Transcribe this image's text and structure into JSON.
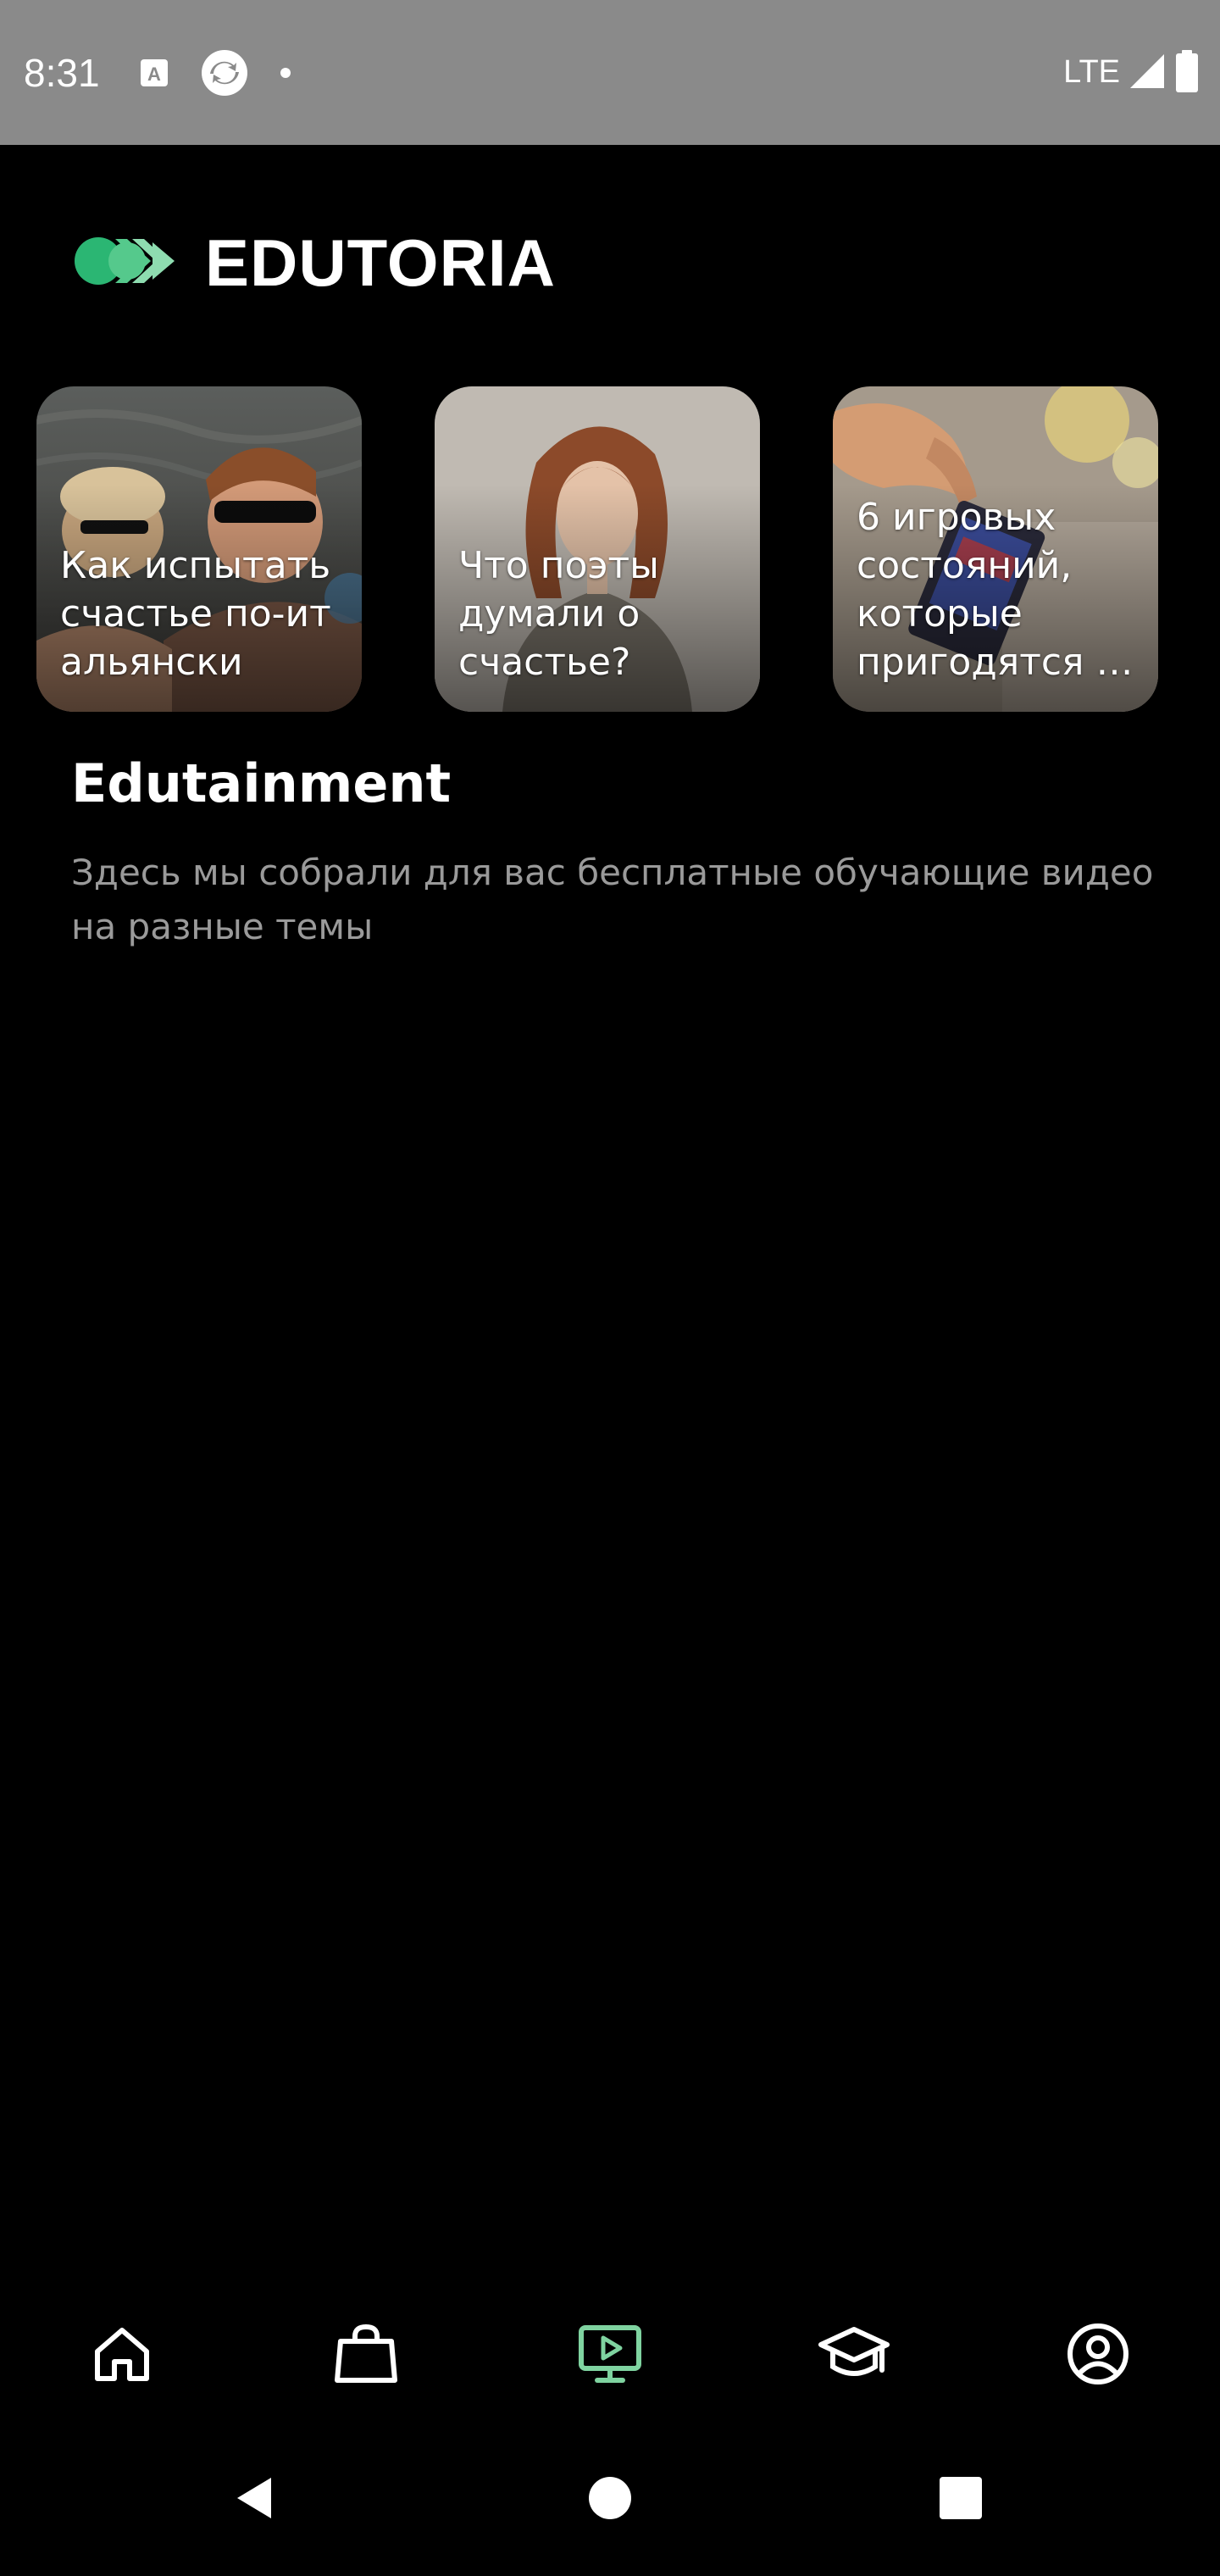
{
  "status_bar": {
    "time": "8:31",
    "network": "LTE",
    "icons": [
      "keyboard-a-icon",
      "sync-app-icon",
      "notification-dot-icon",
      "signal-icon",
      "battery-icon"
    ]
  },
  "app": {
    "brand_name": "EDUTORIA",
    "accent_color": "#2bb673",
    "logo_colors": [
      "#2bb673",
      "#55c98c",
      "#8edcb0"
    ]
  },
  "videos": [
    {
      "title": "Как испытать\nсчастье по-ит\nальянски"
    },
    {
      "title": "Что поэты\nдумали о\nсчастье?"
    },
    {
      "title": "6 игровых\nсостояний,\nкоторые\nпригодятся …"
    }
  ],
  "section": {
    "title": "Edutainment",
    "description": "Здесь мы собрали для вас бесплатные обучающие видео на разные темы"
  },
  "bottom_nav": {
    "active_index": 2,
    "active_color": "#7fd3a0",
    "items": [
      {
        "icon": "home-icon"
      },
      {
        "icon": "shopping-bag-icon"
      },
      {
        "icon": "video-play-icon"
      },
      {
        "icon": "graduation-cap-icon"
      },
      {
        "icon": "profile-icon"
      }
    ]
  },
  "system_nav": {
    "buttons": [
      "back-icon",
      "home-circle-icon",
      "recents-square-icon"
    ]
  }
}
